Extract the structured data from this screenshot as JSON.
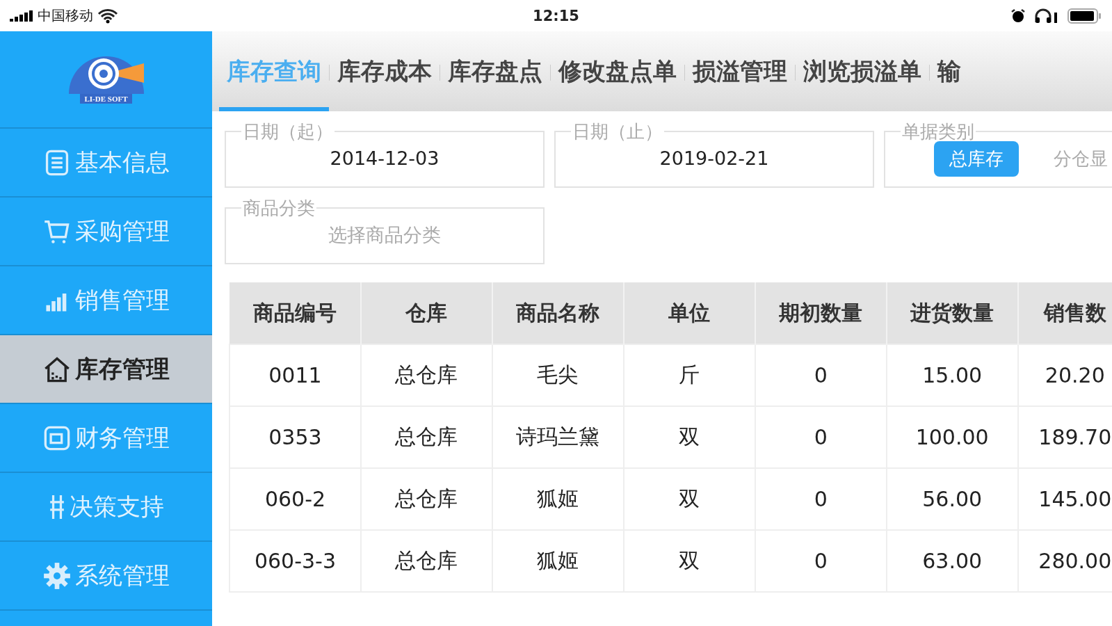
{
  "status_bar": {
    "carrier": "中国移动",
    "time": "12:15"
  },
  "logo": {
    "text": "LI-DE SOFT"
  },
  "sidebar": {
    "items": [
      {
        "label": "基本信息",
        "kind": "document",
        "selected": false
      },
      {
        "label": "采购管理",
        "kind": "cart",
        "selected": false
      },
      {
        "label": "销售管理",
        "kind": "bars",
        "selected": false
      },
      {
        "label": "库存管理",
        "kind": "house",
        "selected": true
      },
      {
        "label": "财务管理",
        "kind": "wallet",
        "selected": false
      },
      {
        "label": "决策支持",
        "kind": "grid",
        "selected": false
      },
      {
        "label": "系统管理",
        "kind": "gear",
        "selected": false
      }
    ]
  },
  "tabs": [
    {
      "label": "库存查询",
      "selected": true
    },
    {
      "label": "库存成本",
      "selected": false
    },
    {
      "label": "库存盘点",
      "selected": false
    },
    {
      "label": "修改盘点单",
      "selected": false
    },
    {
      "label": "损溢管理",
      "selected": false
    },
    {
      "label": "浏览损溢单",
      "selected": false
    },
    {
      "label": "输",
      "selected": false
    }
  ],
  "filters": {
    "start_date": {
      "label": "日期（起）",
      "value": "2014-12-03"
    },
    "end_date": {
      "label": "日期（止）",
      "value": "2019-02-21"
    },
    "doc_type": {
      "label": "单据类别",
      "options": [
        {
          "label": "总库存",
          "selected": true
        },
        {
          "label": "分仓显",
          "selected": false
        }
      ]
    },
    "category": {
      "label": "商品分类",
      "placeholder": "选择商品分类"
    }
  },
  "table": {
    "columns": [
      "商品编号",
      "仓库",
      "商品名称",
      "单位",
      "期初数量",
      "进货数量",
      "销售数"
    ],
    "rows": [
      [
        "0011",
        "总仓库",
        "毛尖",
        "斤",
        "0",
        "15.00",
        "20.20"
      ],
      [
        "0353",
        "总仓库",
        "诗玛兰黛",
        "双",
        "0",
        "100.00",
        "189.70"
      ],
      [
        "060-2",
        "总仓库",
        "狐姬",
        "双",
        "0",
        "56.00",
        "145.00"
      ],
      [
        "060-3-3",
        "总仓库",
        "狐姬",
        "双",
        "0",
        "63.00",
        "280.00"
      ]
    ]
  }
}
